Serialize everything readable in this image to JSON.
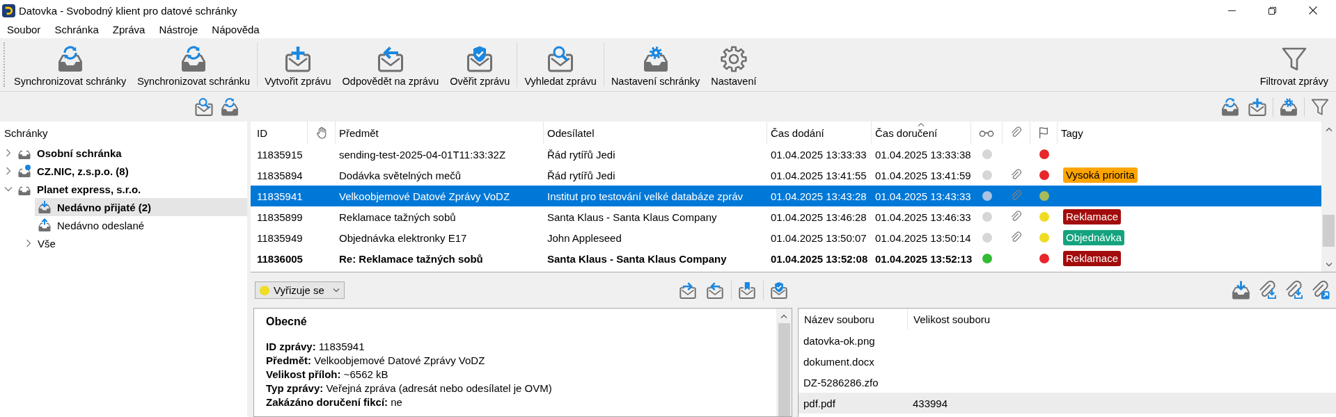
{
  "window": {
    "title": "Datovka - Svobodný klient pro datové schránky"
  },
  "menu": [
    {
      "label": "Soubor"
    },
    {
      "label": "Schránka"
    },
    {
      "label": "Zpráva"
    },
    {
      "label": "Nástroje"
    },
    {
      "label": "Nápověda"
    }
  ],
  "toolbar": {
    "groups": [
      [
        {
          "label": "Synchronizovat schránky"
        },
        {
          "label": "Synchronizovat schránku"
        }
      ],
      [
        {
          "label": "Vytvořit zprávu"
        },
        {
          "label": "Odpovědět na zprávu"
        },
        {
          "label": "Ověřit zprávu"
        }
      ],
      [
        {
          "label": "Vyhledat zprávu"
        }
      ],
      [
        {
          "label": "Nastavení schránky"
        },
        {
          "label": "Nastavení"
        }
      ]
    ],
    "end": [
      {
        "label": "Filtrovat zprávy"
      }
    ]
  },
  "sidebar": {
    "title": "Schránky",
    "accounts": [
      {
        "label": "Osobní schránka",
        "expanded": false,
        "selected": false,
        "badge": false
      },
      {
        "label": "CZ.NIC, z.s.p.o. (8)",
        "expanded": false,
        "selected": false,
        "badge": true
      },
      {
        "label": "Planet express, s.r.o.",
        "expanded": true,
        "selected": false,
        "badge": false,
        "children": [
          {
            "label": "Nedávno přijaté (2)",
            "kind": "received",
            "unread": true,
            "selected": true
          },
          {
            "label": "Nedávno odeslané",
            "kind": "sent",
            "unread": false,
            "selected": false
          },
          {
            "label": "Vše",
            "kind": "all",
            "unread": false,
            "selected": false,
            "expanded": false
          }
        ]
      }
    ]
  },
  "messages": {
    "columns": [
      {
        "label": "ID",
        "kind": "text",
        "sorted": false
      },
      {
        "kind": "icon",
        "sorted": false
      },
      {
        "label": "Předmět",
        "kind": "text",
        "sorted": false
      },
      {
        "label": "Odesílatel",
        "kind": "text",
        "sorted": false
      },
      {
        "label": "Čas dodání",
        "kind": "text",
        "sorted": false
      },
      {
        "label": "Čas doručení",
        "kind": "text",
        "sorted": true
      },
      {
        "kind": "icon",
        "sorted": false
      },
      {
        "kind": "icon",
        "sorted": false
      },
      {
        "kind": "icon",
        "sorted": false
      },
      {
        "label": "Tagy",
        "kind": "text",
        "sorted": false
      }
    ],
    "rows": [
      {
        "id": "11835915",
        "subject": "sending-test-2025-04-01T11:33:32Z",
        "sender": "Řád rytířů Jedi",
        "delivered": "01.04.2025 13:33:33",
        "accepted": "01.04.2025 13:33:38",
        "read_status": {
          "color": "#d6d6d6"
        },
        "attachment": false,
        "process_status": {
          "color": "#e8262b"
        },
        "selected": false,
        "unread": false
      },
      {
        "id": "11835894",
        "subject": "Dodávka světelných mečů",
        "sender": "Řád rytířů Jedi",
        "delivered": "01.04.2025 13:41:55",
        "accepted": "01.04.2025 13:41:59",
        "read_status": {
          "color": "#d6d6d6"
        },
        "attachment": true,
        "process_status": {
          "color": "#e8262b"
        },
        "tags": [
          {
            "label": "Vysoká priorita",
            "color": "#ffa500"
          }
        ],
        "selected": false,
        "unread": false
      },
      {
        "id": "11835941",
        "subject": "Velkoobjemové Datové Zprávy VoDZ",
        "sender": "Institut pro testování velké databáze zpráv",
        "delivered": "01.04.2025 13:43:28",
        "accepted": "01.04.2025 13:43:33",
        "read_status": {
          "color": "#a9c3e3"
        },
        "attachment": true,
        "process_status": {
          "color": "#a8bb5a"
        },
        "selected": true,
        "unread": false
      },
      {
        "id": "11835899",
        "subject": "Reklamace tažných sobů",
        "sender": "Santa Klaus - Santa Klaus Company",
        "delivered": "01.04.2025 13:46:28",
        "accepted": "01.04.2025 13:46:33",
        "read_status": {
          "color": "#d6d6d6"
        },
        "attachment": true,
        "process_status": {
          "color": "#eedd22"
        },
        "tags": [
          {
            "label": "Reklamace",
            "color": "#a30c0c"
          }
        ],
        "selected": false,
        "unread": false
      },
      {
        "id": "11835949",
        "subject": "Objednávka elektronky E17",
        "sender": "John Appleseed",
        "delivered": "01.04.2025 13:50:07",
        "accepted": "01.04.2025 13:50:14",
        "read_status": {
          "color": "#d6d6d6"
        },
        "attachment": true,
        "process_status": {
          "color": "#eedd22"
        },
        "tags": [
          {
            "label": "Objednávka",
            "color": "#14a37e"
          }
        ],
        "selected": false,
        "unread": false
      },
      {
        "id": "11836005",
        "subject": "Re: Reklamace tažných sobů",
        "sender": "Santa Klaus - Santa Klaus Company",
        "delivered": "01.04.2025 13:52:08",
        "accepted": "01.04.2025 13:52:13",
        "read_status": {
          "color": "#33bb33"
        },
        "attachment": false,
        "process_status": {
          "color": "#e8262b"
        },
        "tags": [
          {
            "label": "Reklamace",
            "color": "#a30c0c"
          }
        ],
        "selected": false,
        "unread": true
      }
    ]
  },
  "detail": {
    "status": {
      "label": "Vyřizuje se",
      "color": "#eedd22"
    },
    "title": "Obecné",
    "lines": [
      "**ID zprávy:** 11835941",
      "**Předmět:** Velkoobjemové Datové Zprávy VoDZ",
      "**Velikost příloh:** ~6562 kB",
      "**Typ zprávy:** Veřejná zpráva (adresát nebo odesílatel je OVM)",
      "**Zakázáno doručení fikcí:** ne"
    ]
  },
  "attachments": {
    "columns": [
      {
        "label": "Název souboru"
      },
      {
        "label": "Velikost souboru"
      }
    ],
    "rows": [
      {
        "name": "datovka-ok.png",
        "selected": false
      },
      {
        "name": "dokument.docx",
        "selected": false
      },
      {
        "name": "DZ-5286286.zfo",
        "selected": false
      },
      {
        "name": "pdf.pdf",
        "size": "433994",
        "selected": true
      }
    ]
  }
}
